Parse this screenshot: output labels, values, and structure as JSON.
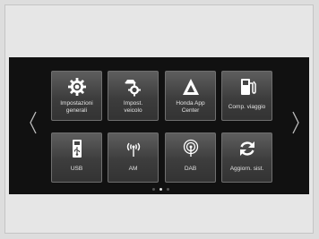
{
  "colors": {
    "screen_bg": "#111111",
    "tile_bg": "#4a4a4a",
    "text": "#e4e4e4",
    "icon": "#ffffff"
  },
  "nav": {
    "prev_icon": "chevron-left-icon",
    "next_icon": "chevron-right-icon"
  },
  "tiles": [
    {
      "line1": "Impostazioni",
      "line2": "generali",
      "icon": "gear-icon"
    },
    {
      "line1": "Impost.",
      "line2": "veicolo",
      "icon": "car-gear-icon"
    },
    {
      "line1": "Honda App",
      "line2": "Center",
      "icon": "app-center-icon"
    },
    {
      "line1": "Comp. viaggio",
      "line2": "",
      "icon": "fuel-pump-icon"
    },
    {
      "line1": "USB",
      "line2": "",
      "icon": "usb-icon"
    },
    {
      "line1": "AM",
      "line2": "",
      "icon": "am-antenna-icon"
    },
    {
      "line1": "DAB",
      "line2": "",
      "icon": "dab-antenna-icon"
    },
    {
      "line1": "Aggiorn. sist.",
      "line2": "",
      "icon": "refresh-icon"
    }
  ],
  "pagination": {
    "count": 3,
    "active_index": 1
  }
}
